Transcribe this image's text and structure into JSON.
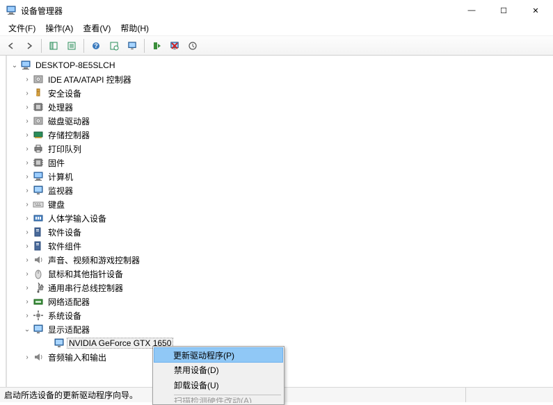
{
  "window": {
    "title": "设备管理器"
  },
  "menu": {
    "file": "文件(F)",
    "action": "操作(A)",
    "view": "查看(V)",
    "help": "帮助(H)"
  },
  "tree": {
    "root": "DESKTOP-8E5SLCH",
    "ide": "IDE ATA/ATAPI 控制器",
    "security": "安全设备",
    "cpu": "处理器",
    "disk": "磁盘驱动器",
    "storage_ctrl": "存储控制器",
    "print_queue": "打印队列",
    "firmware": "固件",
    "computer": "计算机",
    "monitor": "监视器",
    "keyboard": "键盘",
    "hid": "人体学输入设备",
    "software_dev": "软件设备",
    "software_comp": "软件组件",
    "audio_game": "声音、视频和游戏控制器",
    "mouse": "鼠标和其他指针设备",
    "usb": "通用串行总线控制器",
    "network": "网络适配器",
    "system": "系统设备",
    "display": "显示适配器",
    "gpu": "NVIDIA GeForce GTX 1650",
    "audio_io": "音频输入和输出"
  },
  "context_menu": {
    "update_driver": "更新驱动程序(P)",
    "disable_device": "禁用设备(D)",
    "uninstall_device": "卸载设备(U)",
    "partial": "扫描检测硬件改动(A)"
  },
  "status": {
    "text": "启动所选设备的更新驱动程序向导。"
  }
}
